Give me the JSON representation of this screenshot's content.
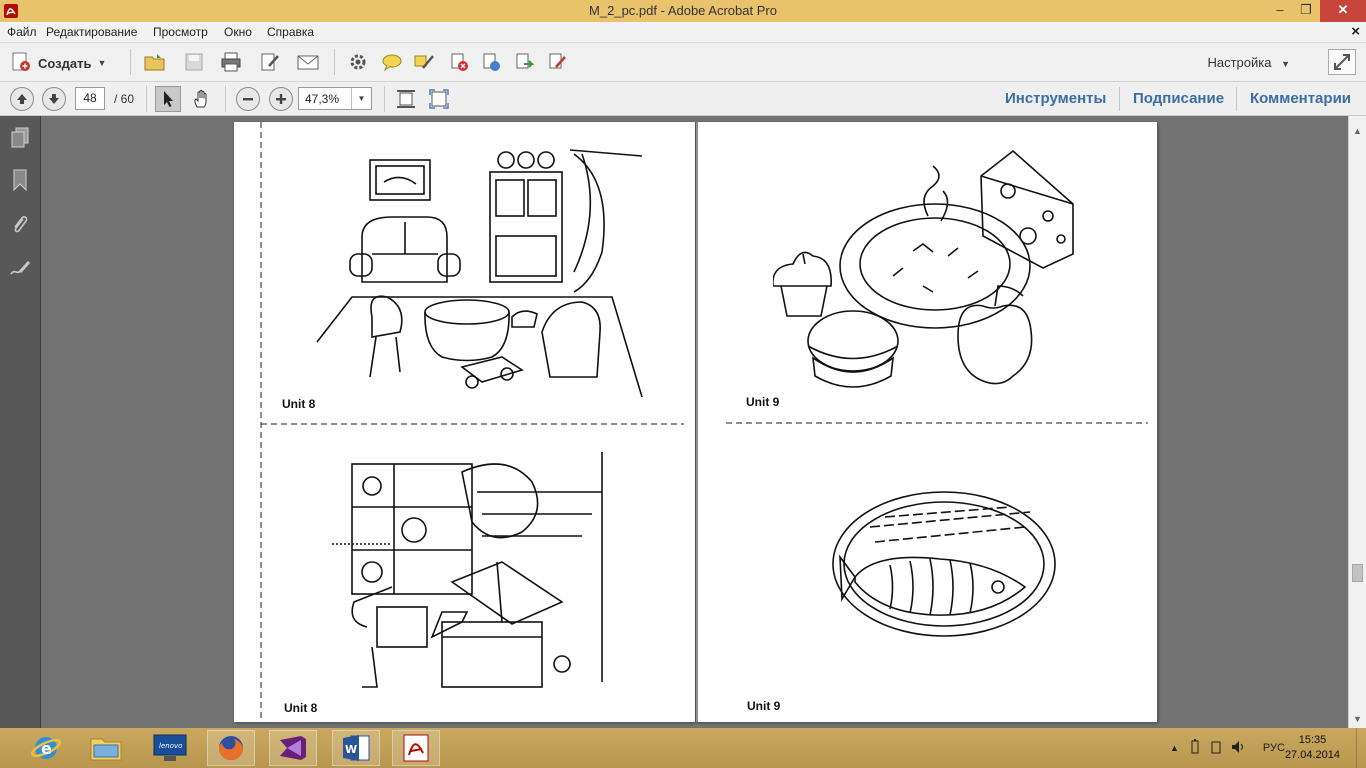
{
  "window": {
    "title": "M_2_pc.pdf - Adobe Acrobat Pro",
    "minimize": "‒",
    "restore": "❐",
    "close": "✕"
  },
  "menu": {
    "items": [
      "Файл",
      "Редактирование",
      "Просмотр",
      "Окно",
      "Справка"
    ],
    "doc_close": "×"
  },
  "toolbar": {
    "create_label": "Создать",
    "customize_label": "Настройка"
  },
  "navigation": {
    "current_page": "48",
    "page_total": "/ 60",
    "zoom": "47,3%"
  },
  "panes": {
    "tools": "Инструменты",
    "sign": "Подписание",
    "comments": "Комментарии"
  },
  "document": {
    "left_page": {
      "top_label": "Unit 8",
      "bottom_label": "Unit 8"
    },
    "right_page": {
      "top_label": "Unit 9",
      "bottom_label": "Unit 9"
    }
  },
  "taskbar": {
    "apps": [
      "internet-explorer-icon",
      "file-explorer-icon",
      "lenovo-icon",
      "firefox-icon",
      "visual-studio-icon",
      "word-icon",
      "acrobat-icon"
    ],
    "language": "РУС",
    "time": "15:35",
    "date": "27.04.2014"
  },
  "colors": {
    "titlebar": "#e9c36c",
    "close_button": "#c7463c",
    "pane_link": "#3b6ea5",
    "doc_background": "#727272"
  }
}
